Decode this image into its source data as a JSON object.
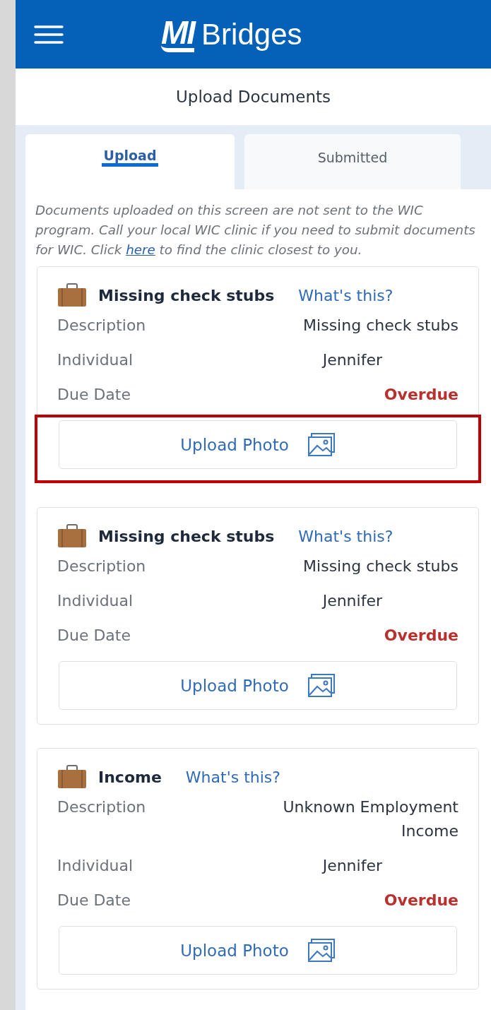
{
  "header": {
    "logo_mark": "MI",
    "logo_text": "Bridges"
  },
  "page_title": "Upload Documents",
  "tabs": [
    {
      "label": "Upload",
      "selected": true
    },
    {
      "label": "Submitted",
      "selected": false
    }
  ],
  "notice": {
    "before": "Documents uploaded on this screen are not sent to the WIC program. Call your local WIC clinic if you need to submit documents for WIC. Click ",
    "link": "here",
    "after": " to find the clinic closest to you."
  },
  "documents": [
    {
      "title": "Missing check stubs",
      "help_link": "What's this?",
      "fields": [
        {
          "label": "Description",
          "value": "Missing check stubs",
          "kind": "text"
        },
        {
          "label": "Individual",
          "value": "Jennifer",
          "kind": "name"
        },
        {
          "label": "Due Date",
          "value": "Overdue",
          "kind": "alert"
        }
      ],
      "button": "Upload Photo",
      "highlighted": true
    },
    {
      "title": "Missing check stubs",
      "help_link": "What's this?",
      "fields": [
        {
          "label": "Description",
          "value": "Missing check stubs",
          "kind": "text"
        },
        {
          "label": "Individual",
          "value": "Jennifer",
          "kind": "name"
        },
        {
          "label": "Due Date",
          "value": "Overdue",
          "kind": "alert"
        }
      ],
      "button": "Upload Photo",
      "highlighted": false
    },
    {
      "title": "Income",
      "help_link": "What's this?",
      "fields": [
        {
          "label": "Description",
          "value": "Unknown Employment Income",
          "kind": "text"
        },
        {
          "label": "Individual",
          "value": "Jennifer",
          "kind": "name"
        },
        {
          "label": "Due Date",
          "value": "Overdue",
          "kind": "alert"
        }
      ],
      "button": "Upload Photo",
      "highlighted": false
    }
  ]
}
